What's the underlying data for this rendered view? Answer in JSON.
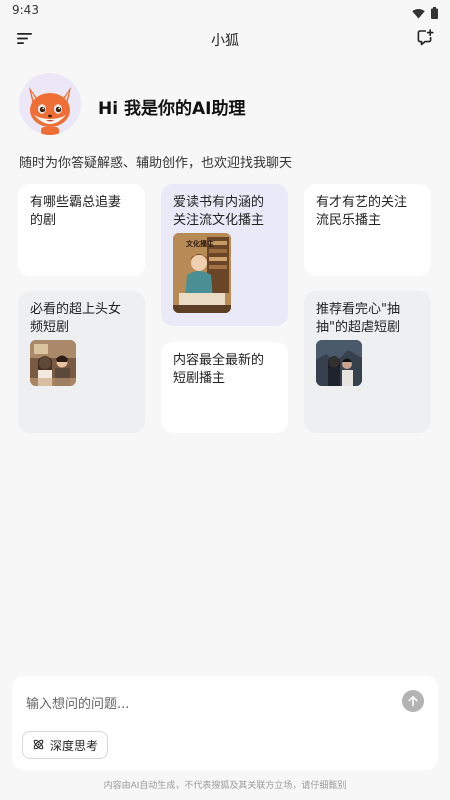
{
  "status_bar": {
    "time": "9:43"
  },
  "header": {
    "title": "小狐"
  },
  "greeting": {
    "title": "Hi 我是你的AI助理",
    "subtitle": "随时为你答疑解惑、辅助创作，也欢迎找我聊天"
  },
  "cards": [
    {
      "text": "有哪些霸总追妻的剧"
    },
    {
      "text": "爱读书有内涵的关注流文化播主",
      "thumb_text": "文化播主"
    },
    {
      "text": "有才有艺的关注流民乐播主"
    },
    {
      "text": "必看的超上头女频短剧"
    },
    {
      "text": "内容最全最新的短剧播主"
    },
    {
      "text": "推荐看完心\"抽抽\"的超虐短剧"
    }
  ],
  "input": {
    "placeholder": "输入想问的问题..."
  },
  "deep_think": {
    "label": "深度思考"
  },
  "disclaimer": "内容由AI自动生成，不代表搜狐及其关联方立场，请仔细甄别"
}
